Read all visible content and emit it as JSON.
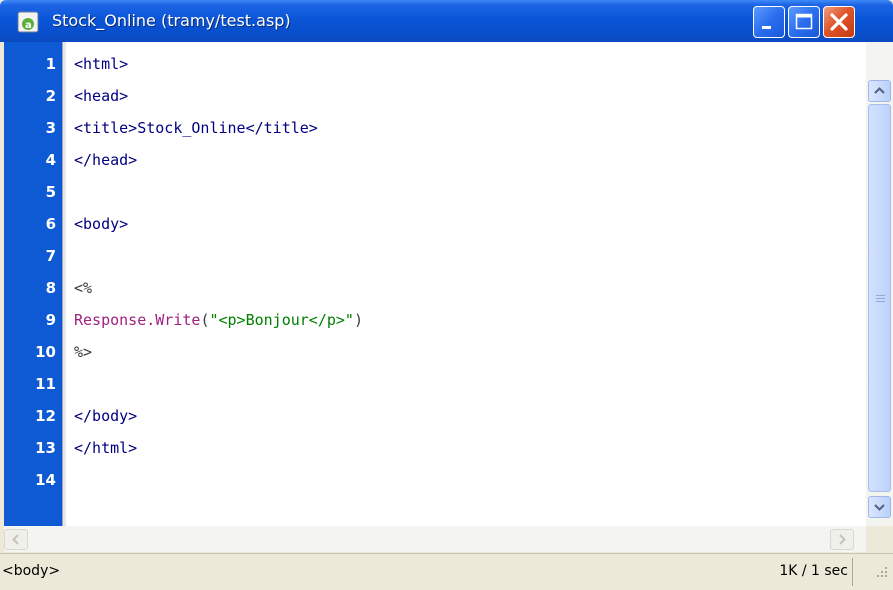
{
  "window": {
    "title": "Stock_Online (tramy/test.asp)"
  },
  "editor": {
    "line_numbers": [
      "1",
      "2",
      "3",
      "4",
      "5",
      "6",
      "7",
      "8",
      "9",
      "10",
      "11",
      "12",
      "13",
      "14"
    ],
    "lines": [
      [
        {
          "t": "<html>",
          "k": "tag"
        }
      ],
      [
        {
          "t": "<head>",
          "k": "tag"
        }
      ],
      [
        {
          "t": "<title>",
          "k": "tag"
        },
        {
          "t": "Stock_Online",
          "k": "tag"
        },
        {
          "t": "</title>",
          "k": "tag"
        }
      ],
      [
        {
          "t": "</head>",
          "k": "tag"
        }
      ],
      [],
      [
        {
          "t": "<body>",
          "k": "tag"
        }
      ],
      [],
      [
        {
          "t": "<%",
          "k": "asp"
        }
      ],
      [
        {
          "t": "Response.Write",
          "k": "fn"
        },
        {
          "t": "(",
          "k": "asp"
        },
        {
          "t": "\"<p>Bonjour</p>\"",
          "k": "str"
        },
        {
          "t": ")",
          "k": "asp"
        }
      ],
      [
        {
          "t": "%>",
          "k": "asp"
        }
      ],
      [],
      [
        {
          "t": "</body>",
          "k": "tag"
        }
      ],
      [
        {
          "t": "</html>",
          "k": "tag"
        }
      ],
      []
    ]
  },
  "statusbar": {
    "tag_path": "<body>",
    "size_time": "1K / 1 sec"
  },
  "colors": {
    "gutter": "#0e5ad4",
    "tag": "#000080",
    "function": "#a02080",
    "string": "#008000"
  },
  "icons": [
    "app-icon",
    "minimize-icon",
    "maximize-icon",
    "close-icon",
    "scroll-up-icon",
    "scroll-down-icon",
    "scroll-left-icon",
    "scroll-right-icon",
    "resize-grip-icon"
  ]
}
